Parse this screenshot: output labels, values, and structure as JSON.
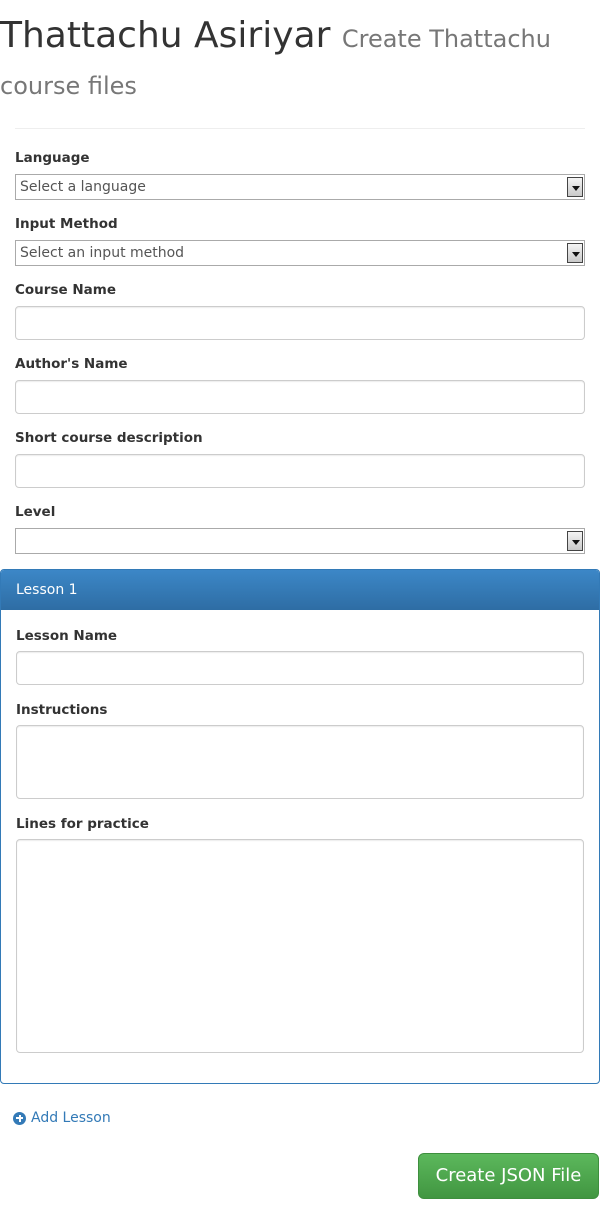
{
  "header": {
    "title": "Thattachu Asiriyar",
    "subtitle": "Create Thattachu course files"
  },
  "form": {
    "language": {
      "label": "Language",
      "selected": "Select a language"
    },
    "input_method": {
      "label": "Input Method",
      "selected": "Select an input method"
    },
    "course_name": {
      "label": "Course Name",
      "value": ""
    },
    "author_name": {
      "label": "Author's Name",
      "value": ""
    },
    "short_description": {
      "label": "Short course description",
      "value": ""
    },
    "level": {
      "label": "Level",
      "selected": ""
    }
  },
  "lessons": [
    {
      "heading": "Lesson 1",
      "lesson_name": {
        "label": "Lesson Name",
        "value": ""
      },
      "instructions": {
        "label": "Instructions",
        "value": ""
      },
      "lines": {
        "label": "Lines for practice",
        "value": ""
      }
    }
  ],
  "actions": {
    "add_lesson": "Add Lesson",
    "create_json": "Create JSON File"
  },
  "colors": {
    "primary": "#337ab7",
    "success": "#5cb85c",
    "text": "#333333",
    "muted": "#777777"
  },
  "icons": {
    "add_lesson": "plus-circle-icon"
  }
}
